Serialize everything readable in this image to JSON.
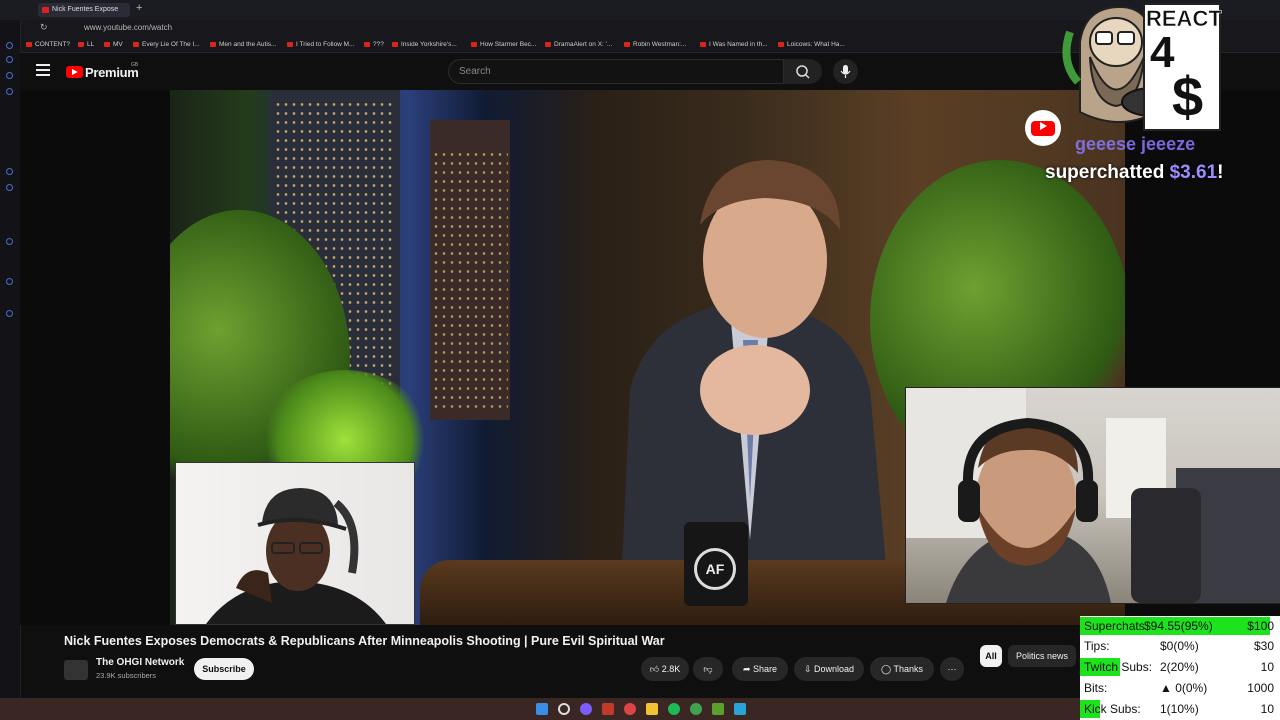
{
  "browser": {
    "tab_title": "Nick Fuentes Expose",
    "url": "www.youtube.com/watch",
    "bookmarks": [
      "CONTENT?",
      "LL",
      "MV",
      "Every Lie Of The I...",
      "Men and the Autis...",
      "I Tried to Follow M...",
      "???",
      "Inside Yorkshire's...",
      "How Starmer Bec...",
      "DramaAlert on X: '...",
      "Robin Westman:...",
      "I Was Named in th...",
      "Loicows: What Ha..."
    ]
  },
  "youtube": {
    "brand": "Premium",
    "region": "GB",
    "search_placeholder": "Search"
  },
  "overlay": {
    "react_label": "REACT",
    "react_4": "4",
    "react_dollar": "$",
    "superchat_user": "geeese jeeeze",
    "superchat_text": "superchatted",
    "superchat_amount": "$3.61",
    "superchat_bang": "!",
    "mug_logo": "AF"
  },
  "video": {
    "title": "Nick Fuentes Exposes Democrats & Republicans After Minneapolis Shooting | Pure Evil Spiritual War",
    "channel_name": "The OHGI Network",
    "subscribers": "23.9K subscribers",
    "subscribe_label": "Subscribe",
    "likes": "2.8K",
    "share_label": "Share",
    "download_label": "Download",
    "thanks_label": "Thanks",
    "more_label": "⋯"
  },
  "chips": {
    "all": "All",
    "politics": "Politics news"
  },
  "goals": [
    {
      "label": "Superchats",
      "value": "$94.55(95%)",
      "target": "$100",
      "progress": 0.95
    },
    {
      "label": "Tips:",
      "value": "$0(0%)",
      "target": "$30",
      "progress": 0.0
    },
    {
      "label": "Twitch Subs:",
      "value": "2(20%)",
      "target": "10",
      "progress": 0.2
    },
    {
      "label": "Bits:",
      "value": "▲ 0(0%)",
      "target": "1000",
      "progress": 0.0
    },
    {
      "label": "Kick Subs:",
      "value": "1(10%)",
      "target": "10",
      "progress": 0.1
    }
  ],
  "colors": {
    "youtube_red": "#ff0000",
    "goal_green": "#1de31d",
    "superchat_purple": "#8a78ff"
  }
}
